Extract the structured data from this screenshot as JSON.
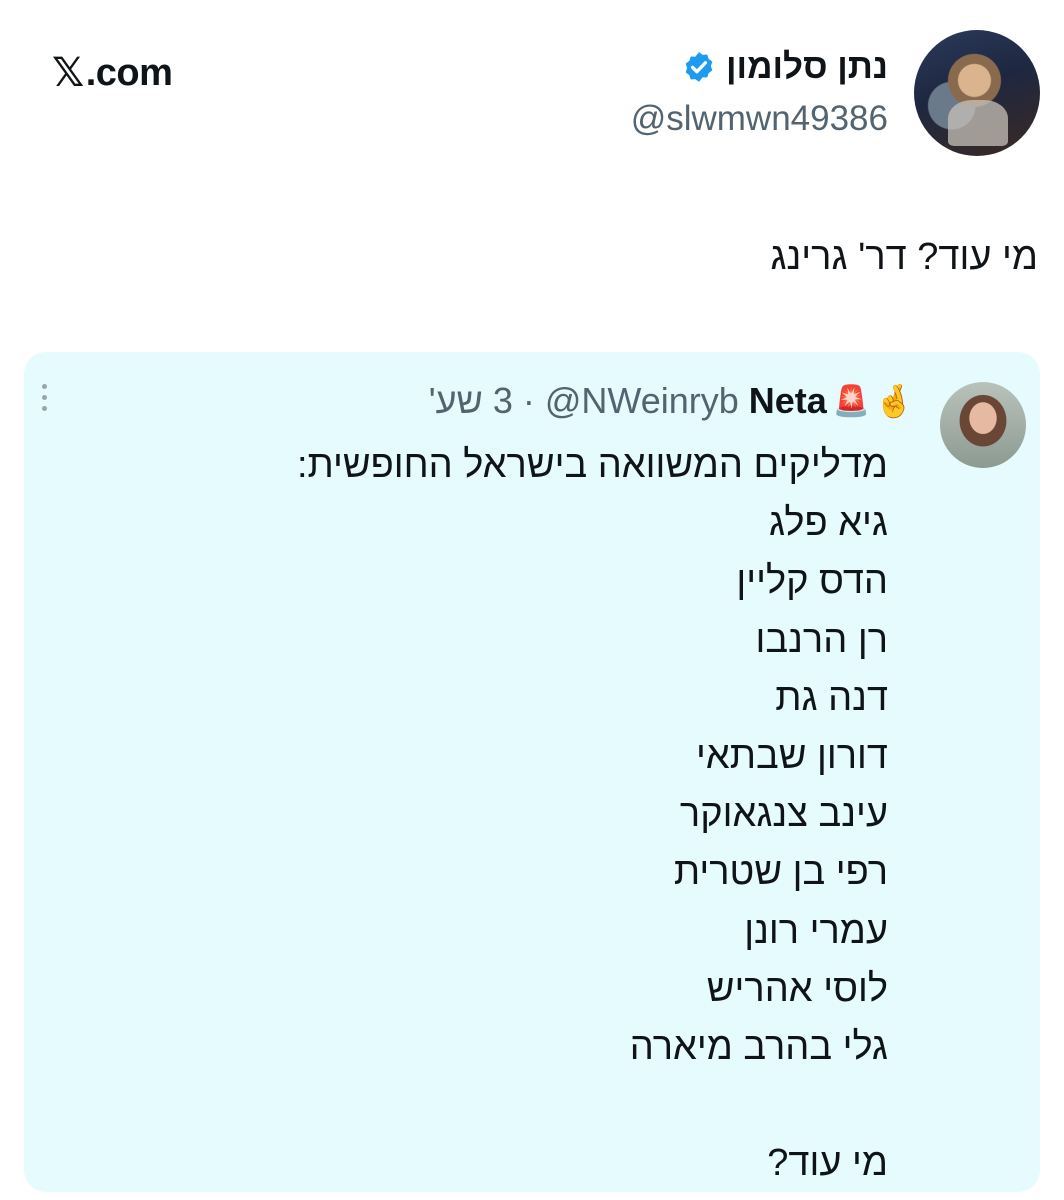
{
  "brand": {
    "x": "𝕏",
    "label": ".com"
  },
  "author": {
    "display_name": "נתן סלומון",
    "handle": "@slwmwn49386",
    "verified_color": "#1d9bf0"
  },
  "tweet": {
    "text": "מי עוד? דר' גרינג"
  },
  "quote": {
    "name": "Neta",
    "emojis": [
      "🤞",
      "🚨"
    ],
    "handle": "@NWeinryb",
    "separator": "·",
    "time": "3 שע'",
    "lines": [
      "מדליקים המשוואה בישראל החופשית:",
      "גיא פלג",
      "הדס קליין",
      "רן הרנבו",
      "דנה גת",
      "דורון שבתאי",
      "עינב צנגאוקר",
      "רפי בן שטרית",
      "עמרי רונן",
      "לוסי אהריש",
      "גלי בהרב מיארה",
      "",
      "מי עוד?"
    ]
  },
  "colors": {
    "card_bg": "#e6fbfd",
    "secondary_text": "#536471"
  }
}
